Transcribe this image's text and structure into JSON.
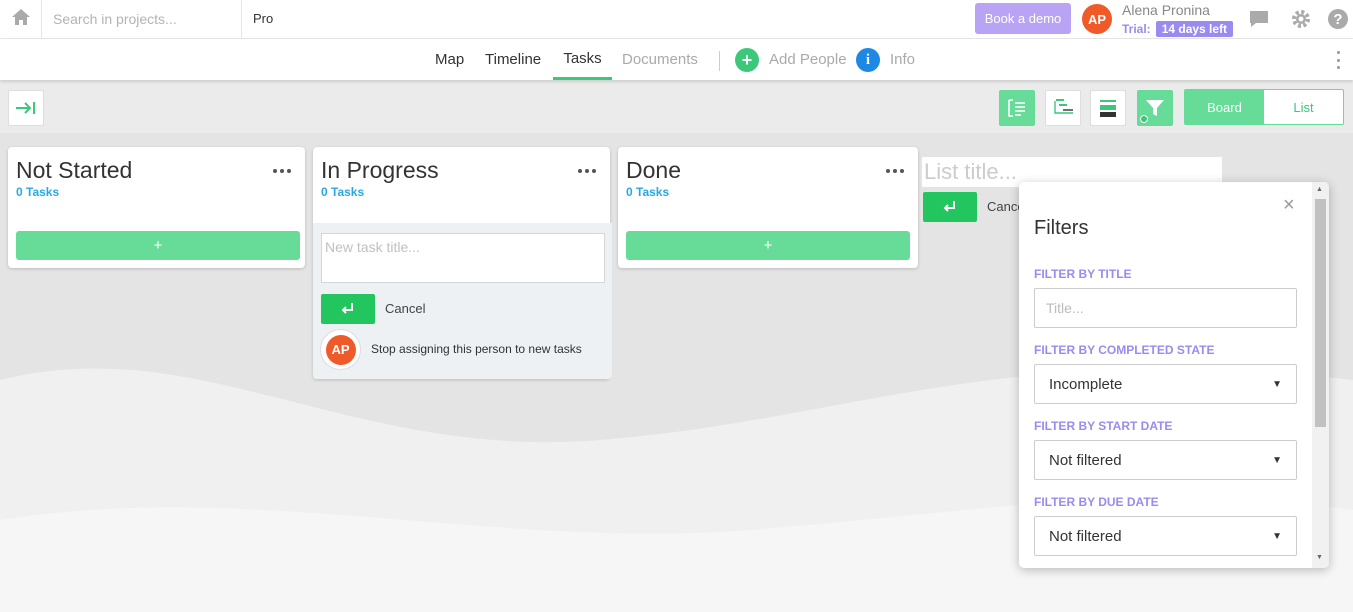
{
  "topbar": {
    "search_placeholder": "Search in projects...",
    "project_name": "Pro",
    "book_demo_label": "Book a demo",
    "user_initials": "AP",
    "user_name": "Alena Pronina",
    "trial_label": "Trial:",
    "trial_badge": "14 days left",
    "icons": [
      "home-icon",
      "chat-icon",
      "gear-icon",
      "help-icon"
    ]
  },
  "nav": {
    "tabs": [
      {
        "label": "Map",
        "active": false
      },
      {
        "label": "Timeline",
        "active": false
      },
      {
        "label": "Tasks",
        "active": true
      },
      {
        "label": "Documents",
        "active": false
      }
    ],
    "add_people_label": "Add People",
    "info_label": "Info",
    "info_icon_glyph": "i"
  },
  "toolbar": {
    "board_label": "Board",
    "list_label": "List"
  },
  "board": {
    "columns": [
      {
        "title": "Not Started",
        "count": "0 Tasks",
        "add_label": "+"
      },
      {
        "title": "In Progress",
        "count": "0 Tasks"
      },
      {
        "title": "Done",
        "count": "0 Tasks",
        "add_label": "+"
      }
    ],
    "new_task_placeholder": "New task title...",
    "cancel_label": "Cancel",
    "assign_initials": "AP",
    "assign_text": "Stop assigning this person to new tasks",
    "list_title_placeholder": "List title...",
    "list_cancel_label": "Cance"
  },
  "filters": {
    "title": "Filters",
    "close_glyph": "×",
    "title_label": "FILTER BY TITLE",
    "title_placeholder": "Title...",
    "completed_label": "FILTER BY COMPLETED STATE",
    "completed_value": "Incomplete",
    "start_label": "FILTER BY START DATE",
    "start_value": "Not filtered",
    "due_label": "FILTER BY DUE DATE",
    "due_value": "Not filtered"
  },
  "colors": {
    "accent_green": "#66dc98",
    "enter_green": "#22c55e",
    "purple": "#9b8af0",
    "avatar_orange": "#f05a28",
    "info_blue": "#1e88e5"
  }
}
